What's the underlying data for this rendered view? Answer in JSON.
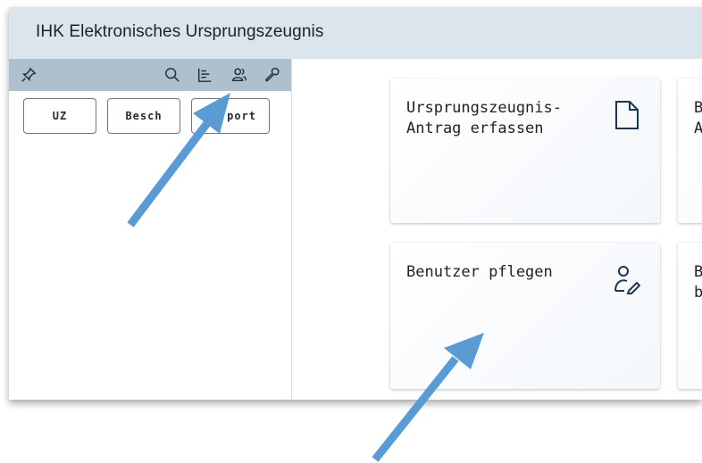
{
  "app": {
    "title": "IHK Elektronisches Ursprungszeugnis"
  },
  "sidebar": {
    "toolbar_icons": [
      "pin-icon",
      "search-icon",
      "hierarchy-icon",
      "users-icon",
      "wrench-icon"
    ],
    "buttons": [
      {
        "label": "UZ"
      },
      {
        "label": "Besch"
      },
      {
        "label": "port"
      }
    ]
  },
  "tiles": [
    {
      "title": "Ursprungszeugnis-\nAntrag erfassen",
      "icon": "document-icon"
    },
    {
      "title": "B\nA",
      "icon": ""
    },
    {
      "title": "Benutzer pflegen",
      "icon": "user-edit-icon"
    },
    {
      "title": "B\nb",
      "icon": ""
    }
  ],
  "colors": {
    "titlebar": "#dbe5ee",
    "sidebar_toolbar": "#aebfcd",
    "arrow": "#5b9bd5",
    "icon_dark": "#1f3550"
  }
}
